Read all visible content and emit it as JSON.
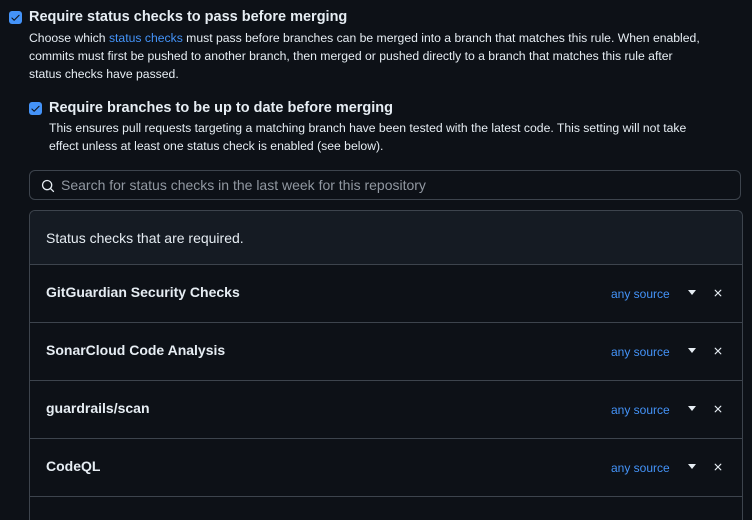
{
  "main_rule": {
    "title": "Require status checks to pass before merging",
    "desc_prefix": "Choose which ",
    "desc_link": "status checks",
    "desc_line1_suffix": " must pass before branches can be merged into a branch that matches this rule. When enabled,",
    "desc_line2": "commits must first be pushed to another branch, then merged or pushed directly to a branch that matches this rule after",
    "desc_line3": "status checks have passed.",
    "checked": true
  },
  "sub_rule": {
    "title": "Require branches to be up to date before merging",
    "desc_line1": "This ensures pull requests targeting a matching branch have been tested with the latest code. This setting will not take",
    "desc_line2": "effect unless at least one status check is enabled (see below).",
    "checked": true
  },
  "search": {
    "placeholder": "Search for status checks in the last week for this repository"
  },
  "required_panel": {
    "header": "Status checks that are required.",
    "checks": [
      {
        "name": "GitGuardian Security Checks",
        "source": "any source"
      },
      {
        "name": "SonarCloud Code Analysis",
        "source": "any source"
      },
      {
        "name": "guardrails/scan",
        "source": "any source"
      },
      {
        "name": "CodeQL",
        "source": "any source"
      }
    ]
  },
  "colors": {
    "background": "#0d1117",
    "accent": "#4493f8",
    "border": "#3d444d",
    "header_bg": "#151b23",
    "text": "#e6edf3",
    "muted": "#9198a1"
  }
}
